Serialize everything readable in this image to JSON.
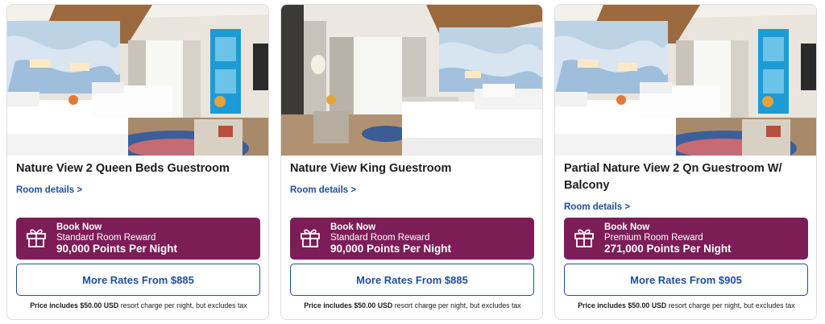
{
  "cards": [
    {
      "title": "Nature View 2 Queen Beds Guestroom",
      "details_link": "Room details >",
      "photo": "room-two-queen-beds-photo",
      "book_now": "Book Now",
      "reward_type": "Standard Room Reward",
      "points": "90,000 Points Per Night",
      "more_rates": "More Rates From $885",
      "price_note_amount": "Price includes $50.00 USD",
      "price_note_rest": " resort charge per night, but excludes tax"
    },
    {
      "title": "Nature View King Guestroom",
      "details_link": "Room details >",
      "photo": "room-king-bed-photo",
      "book_now": "Book Now",
      "reward_type": "Standard Room Reward",
      "points": "90,000 Points Per Night",
      "more_rates": "More Rates From $885",
      "price_note_amount": "Price includes $50.00 USD",
      "price_note_rest": " resort charge per night, but excludes tax"
    },
    {
      "title": "Partial Nature View 2 Qn Guestroom W/ Balcony",
      "details_link": "Room details >",
      "photo": "room-two-queen-balcony-photo",
      "book_now": "Book Now",
      "reward_type": "Premium Room Reward",
      "points": "271,000 Points Per Night",
      "more_rates": "More Rates From $905",
      "price_note_amount": "Price includes $50.00 USD",
      "price_note_rest": " resort charge per night, but excludes tax"
    }
  ],
  "colors": {
    "reward_button": "#7c1d58",
    "link_blue": "#1f4e9c"
  },
  "icons": [
    "gift-icon"
  ]
}
